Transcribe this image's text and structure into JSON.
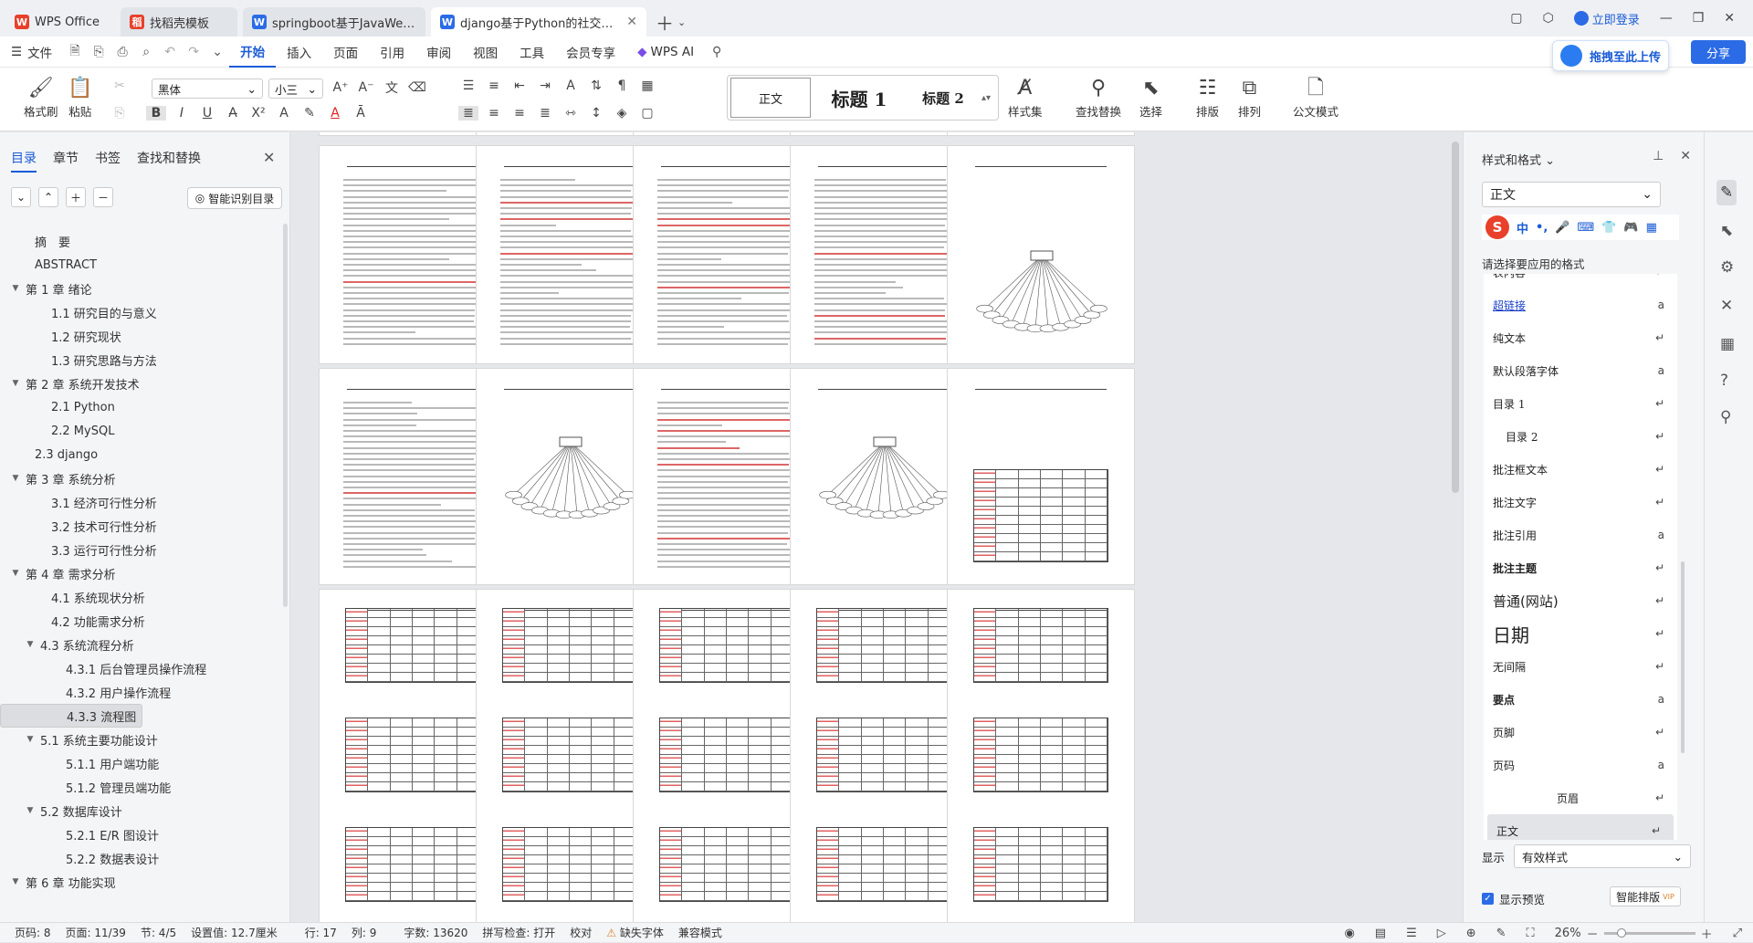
{
  "tabs": [
    {
      "label": "WPS Office",
      "icon": "wps-logo-icon",
      "color": "#e8402a"
    },
    {
      "label": "找稻壳模板",
      "icon": "docer-icon",
      "color": "#e8402a"
    },
    {
      "label": "springboot基于JavaWeb的房产信息",
      "icon": "word-doc-icon",
      "color": "#2b6be6"
    },
    {
      "label": "django基于Python的社交音乐网站",
      "icon": "word-doc-icon",
      "color": "#2b6be6"
    }
  ],
  "window": {
    "login": "立即登录"
  },
  "menu": {
    "file": "文件",
    "items": [
      "开始",
      "插入",
      "页面",
      "引用",
      "审阅",
      "视图",
      "工具",
      "会员专享"
    ],
    "active": "开始",
    "wps_ai": "WPS AI"
  },
  "ribbon": {
    "painter": "格式刷",
    "paste": "粘贴",
    "font": "黑体",
    "size": "小三",
    "styles": [
      "正文",
      "标题 1",
      "标题 2"
    ],
    "style_set": "样式集",
    "find_replace": "查找替换",
    "select": "选择",
    "layout": "排版",
    "arrange": "排列",
    "official": "公文模式"
  },
  "upload": "拖拽至此上传",
  "share": "分享",
  "left": {
    "tabs": [
      "目录",
      "章节",
      "书签",
      "查找和替换"
    ],
    "smart_toc": "智能识别目录",
    "toc": [
      {
        "t": "摘　要",
        "lvl": 1,
        "arrow": false
      },
      {
        "t": "ABSTRACT",
        "lvl": 1,
        "arrow": false
      },
      {
        "t": "第 1 章  绪论",
        "lvl": 1,
        "arrow": true
      },
      {
        "t": "1.1  研究目的与意义",
        "lvl": 2,
        "arrow": false
      },
      {
        "t": "1.2  研究现状",
        "lvl": 2,
        "arrow": false
      },
      {
        "t": "1.3  研究思路与方法",
        "lvl": 2,
        "arrow": false
      },
      {
        "t": "第 2 章  系统开发技术",
        "lvl": 1,
        "arrow": true
      },
      {
        "t": "2.1 Python",
        "lvl": 2,
        "arrow": false
      },
      {
        "t": "2.2 MySQL",
        "lvl": 2,
        "arrow": false
      },
      {
        "t": "2.3 django",
        "lvl": 1,
        "arrow": false
      },
      {
        "t": "第 3 章  系统分析",
        "lvl": 1,
        "arrow": true
      },
      {
        "t": "3.1  经济可行性分析",
        "lvl": 2,
        "arrow": false
      },
      {
        "t": "3.2  技术可行性分析",
        "lvl": 2,
        "arrow": false
      },
      {
        "t": "3.3  运行可行性分析",
        "lvl": 2,
        "arrow": false
      },
      {
        "t": "第 4 章  需求分析",
        "lvl": 1,
        "arrow": true
      },
      {
        "t": "4.1  系统现状分析",
        "lvl": 2,
        "arrow": false
      },
      {
        "t": "4.2  功能需求分析",
        "lvl": 2,
        "arrow": false
      },
      {
        "t": "4.3  系统流程分析",
        "lvl": 2,
        "arrow": true
      },
      {
        "t": "4.3.1 后台管理员操作流程",
        "lvl": 3,
        "arrow": false
      },
      {
        "t": "4.3.2 用户操作流程",
        "lvl": 3,
        "arrow": false
      },
      {
        "t": "4.3.3 流程图",
        "lvl": 3,
        "arrow": false,
        "selected": true
      },
      {
        "t": "第 5 章  系统设计",
        "lvl": 1,
        "arrow": true
      },
      {
        "t": "5.1  系统主要功能设计",
        "lvl": 2,
        "arrow": true
      },
      {
        "t": "5.1.1  用户端功能",
        "lvl": 3,
        "arrow": false
      },
      {
        "t": "5.1.2  管理员端功能",
        "lvl": 3,
        "arrow": false
      },
      {
        "t": "5.2  数据库设计",
        "lvl": 2,
        "arrow": true
      },
      {
        "t": "5.2.1 E/R 图设计",
        "lvl": 3,
        "arrow": false
      },
      {
        "t": "5.2.2  数据表设计",
        "lvl": 3,
        "arrow": false
      },
      {
        "t": "第 6 章  功能实现",
        "lvl": 1,
        "arrow": true
      }
    ]
  },
  "right": {
    "title": "样式和格式",
    "current": "正文",
    "apply_label": "请选择要应用的格式",
    "styles": [
      {
        "t": "表内容",
        "mark": "↵"
      },
      {
        "t": "超链接",
        "mark": "a",
        "cls": "link"
      },
      {
        "t": "纯文本",
        "mark": "↵"
      },
      {
        "t": "默认段落字体",
        "mark": "a"
      },
      {
        "t": "目录 1",
        "mark": "↵",
        "cls": "serif"
      },
      {
        "t": "目录 2",
        "mark": "↵",
        "cls": "serif indent"
      },
      {
        "t": "批注框文本",
        "mark": "↵"
      },
      {
        "t": "批注文字",
        "mark": "↵"
      },
      {
        "t": "批注引用",
        "mark": "a"
      },
      {
        "t": "批注主题",
        "mark": "↵",
        "cls": "bold"
      },
      {
        "t": "普通(网站)",
        "mark": "↵",
        "cls": "big"
      },
      {
        "t": "日期",
        "mark": "↵",
        "cls": "huge"
      },
      {
        "t": "无间隔",
        "mark": "↵"
      },
      {
        "t": "要点",
        "mark": "a",
        "cls": "bold"
      },
      {
        "t": "页脚",
        "mark": "↵"
      },
      {
        "t": "页码",
        "mark": "a"
      },
      {
        "t": "页眉",
        "mark": "↵",
        "cls": "center"
      },
      {
        "t": "正文",
        "mark": "↵",
        "cls": "selected"
      }
    ],
    "show_label": "显示",
    "show_value": "有效样式",
    "preview": "显示预览",
    "smart_layout": "智能排版"
  },
  "status": {
    "page_no": "页码: 8",
    "page": "页面: 11/39",
    "section": "节: 4/5",
    "setting": "设置值: 12.7厘米",
    "row": "行: 17",
    "col": "列: 9",
    "words": "字数: 13620",
    "spell": "拼写检查: 打开",
    "proof": "校对",
    "missing_font": "缺失字体",
    "compat": "兼容模式",
    "zoom": "26%"
  }
}
